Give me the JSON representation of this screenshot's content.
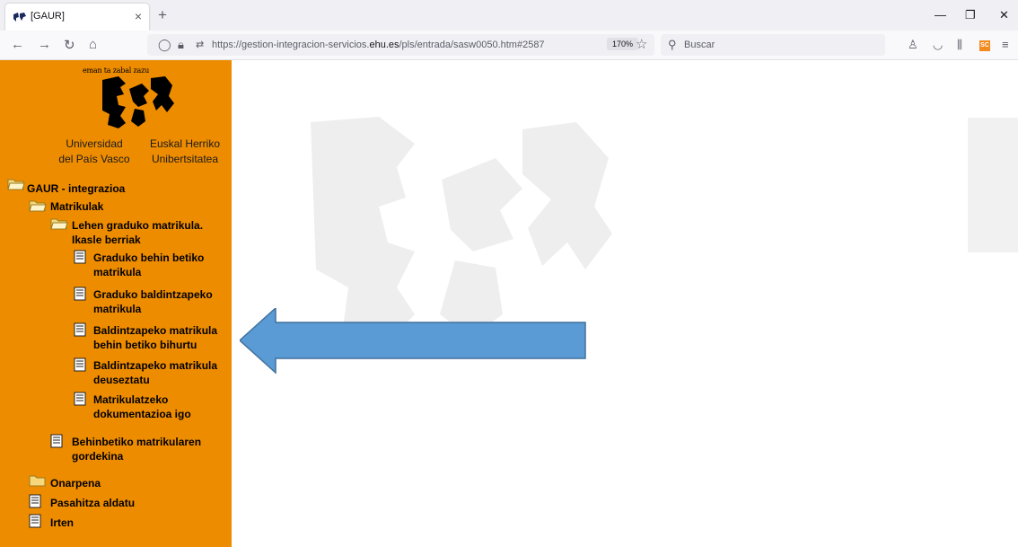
{
  "browser": {
    "tab_title": "[GAUR]",
    "url_prefix": "https://gestion-integracion-servicios.",
    "url_domain": "ehu.es",
    "url_suffix": "/pls/entrada/sasw0050.htm#2587",
    "zoom": "170%",
    "search_placeholder": "Buscar",
    "ext_badge": "SC"
  },
  "sidebar": {
    "motto": "eman ta zabal zazu",
    "uni_es": [
      "Universidad",
      "del País Vasco"
    ],
    "uni_eu": [
      "Euskal Herriko",
      "Unibertsitatea"
    ],
    "tree": {
      "root": "GAUR - integrazioa",
      "matrikulak": "Matrikulak",
      "lehen_graduko": [
        "Lehen graduko matrikula.",
        "Ikasle berriak"
      ],
      "items": [
        [
          "Graduko behin betiko",
          "matrikula"
        ],
        [
          "Graduko baldintzapeko",
          "matrikula"
        ],
        [
          "Baldintzapeko matrikula",
          "behin betiko bihurtu"
        ],
        [
          "Baldintzapeko matrikula",
          "deuseztatu"
        ],
        [
          "Matrikulatzeko",
          "dokumentazioa igo"
        ]
      ],
      "behinbetiko": [
        "Behinbetiko matrikularen",
        "gordekina"
      ],
      "onarpena": "Onarpena",
      "pasahitza": "Pasahitza aldatu",
      "irten": "Irten"
    }
  },
  "colors": {
    "sidebar": "#ee8c00",
    "arrow": "#5b9bd5",
    "arrow_stroke": "#41719c"
  },
  "icons": {
    "folder": "folder-icon",
    "document": "document-icon"
  }
}
